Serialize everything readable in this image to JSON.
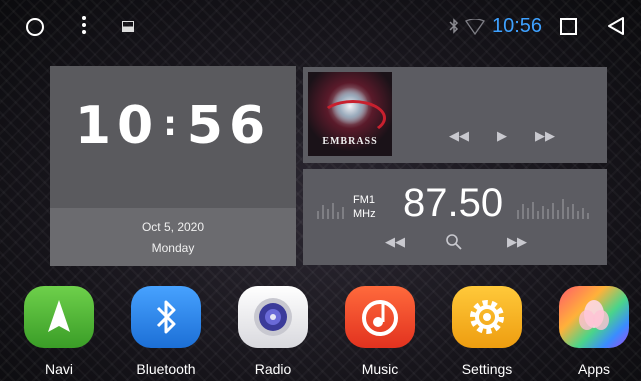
{
  "status_bar": {
    "time": "10:56",
    "time_color": "#3ea1ff",
    "icons": [
      "home-circle-icon",
      "overflow-menu-icon",
      "gallery-icon",
      "bluetooth-icon",
      "wifi-icon",
      "recents-icon",
      "back-icon"
    ]
  },
  "clock_widget": {
    "hours": "10",
    "separator": ":",
    "minutes": "56",
    "date": "Oct 5, 2020",
    "weekday": "Monday"
  },
  "music_widget": {
    "album_art_text": "EMBRASS",
    "controls": [
      "previous-icon",
      "play-icon",
      "next-icon"
    ]
  },
  "radio_widget": {
    "band": "FM1",
    "unit": "MHz",
    "frequency": "87.50",
    "controls": [
      "seek-back-icon",
      "search-icon",
      "seek-forward-icon"
    ]
  },
  "dock": {
    "apps": [
      {
        "label": "Navi",
        "icon": "navi-icon",
        "color": "#5ac23b"
      },
      {
        "label": "Bluetooth",
        "icon": "bluetooth-icon",
        "color": "#2f8cf0"
      },
      {
        "label": "Radio",
        "icon": "radio-icon",
        "color": "#e9e9ee"
      },
      {
        "label": "Music",
        "icon": "music-icon",
        "color": "#ee4a2d"
      },
      {
        "label": "Settings",
        "icon": "settings-gear-icon",
        "color": "#f3b41c"
      },
      {
        "label": "Apps",
        "icon": "apps-flower-icon",
        "color": "#8a5cf0"
      }
    ]
  }
}
